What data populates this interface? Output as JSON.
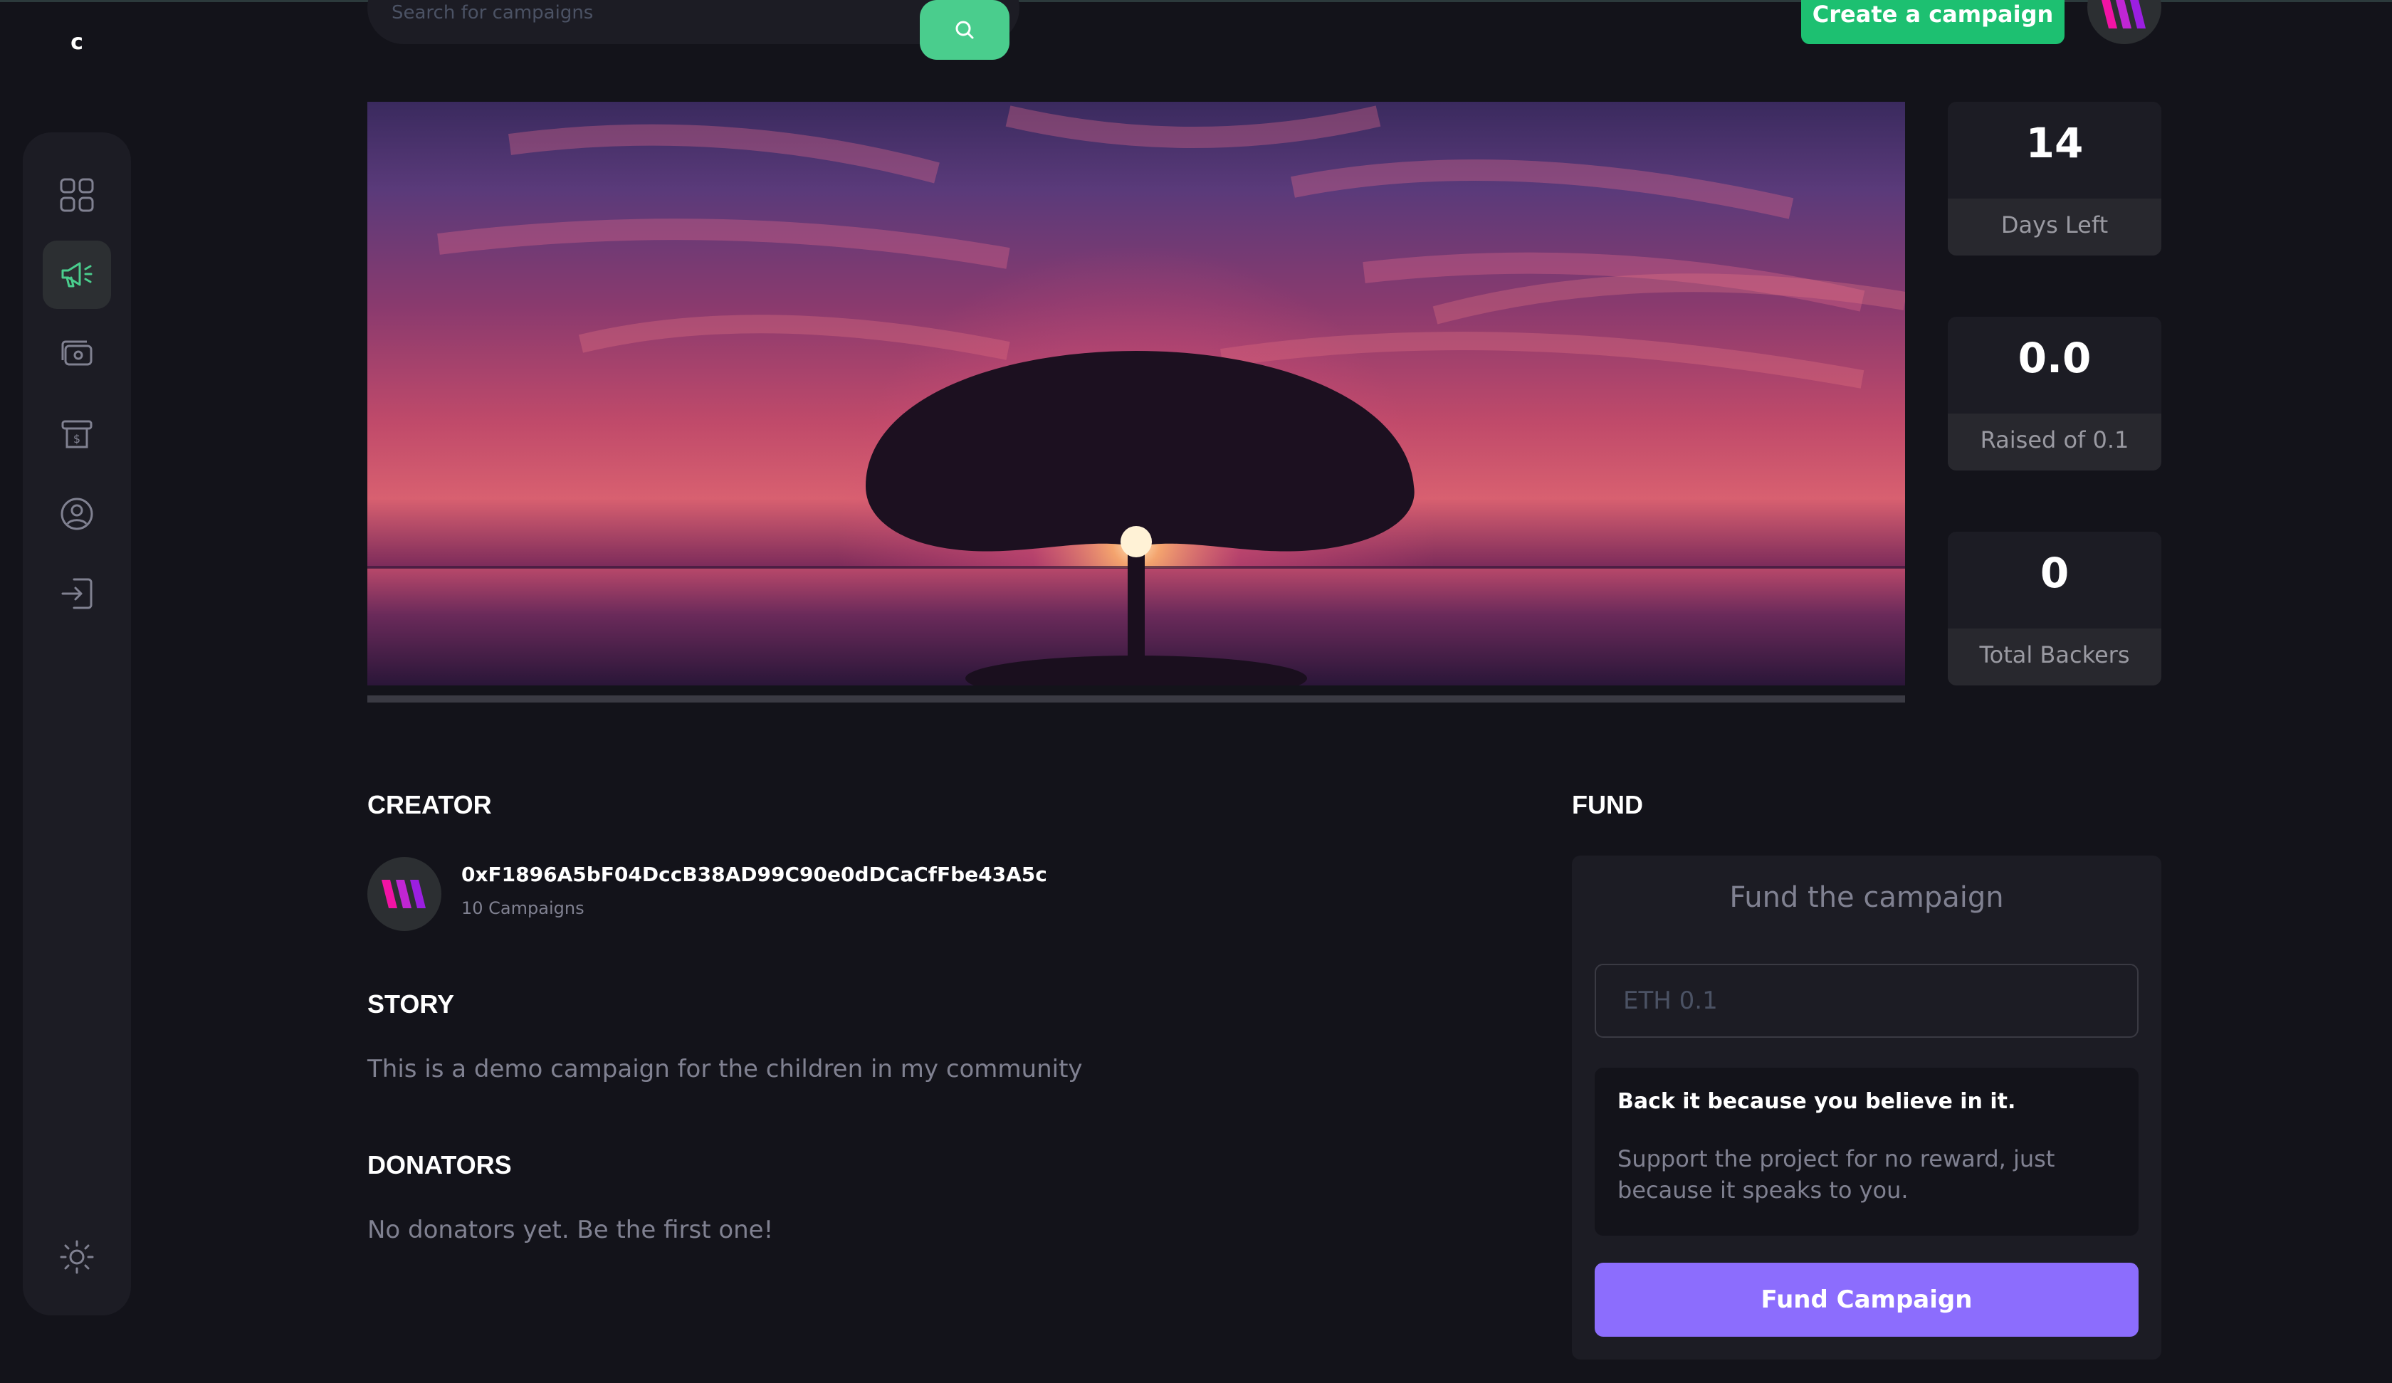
{
  "app": {
    "logo_text": "c"
  },
  "sidebar": {
    "items": [
      {
        "name": "dashboard",
        "icon": "dashboard-icon",
        "active": false
      },
      {
        "name": "campaign",
        "icon": "campaign-icon",
        "active": true
      },
      {
        "name": "payment",
        "icon": "payment-icon",
        "active": false
      },
      {
        "name": "withdraw",
        "icon": "withdraw-icon",
        "active": false
      },
      {
        "name": "profile",
        "icon": "profile-icon",
        "active": false
      },
      {
        "name": "logout",
        "icon": "logout-icon",
        "active": false
      }
    ],
    "theme_icon": "sun-icon"
  },
  "header": {
    "search_placeholder": "Search for campaigns",
    "search_icon": "search-icon",
    "create_label": "Create a campaign",
    "avatar_icon": "thirdweb-logo-icon"
  },
  "campaign": {
    "progress_fraction": 0.0,
    "stats": [
      {
        "value": "14",
        "label": "Days Left"
      },
      {
        "value": "0.0",
        "label": "Raised of 0.1"
      },
      {
        "value": "0",
        "label": "Total Backers"
      }
    ],
    "creator_heading": "CREATOR",
    "creator_address": "0xF1896A5bF04DccB38AD99C90e0dDCaCfFbe43A5c",
    "creator_campaigns": "10 Campaigns",
    "story_heading": "STORY",
    "story_text": "This is a demo campaign for the children in my community",
    "donators_heading": "DONATORS",
    "donators_text": "No donators yet. Be the first one!"
  },
  "fund": {
    "heading": "FUND",
    "card_title": "Fund the campaign",
    "input_placeholder": "ETH 0.1",
    "note_title": "Back it because you believe in it.",
    "note_body": "Support the project for no reward, just because it speaks to you.",
    "button_label": "Fund Campaign"
  },
  "colors": {
    "background": "#13131a",
    "card": "#1c1c24",
    "accent_green": "#1dc071",
    "search_green": "#4acd8d",
    "accent_purple": "#8c6dfd",
    "muted_text": "#808191"
  }
}
